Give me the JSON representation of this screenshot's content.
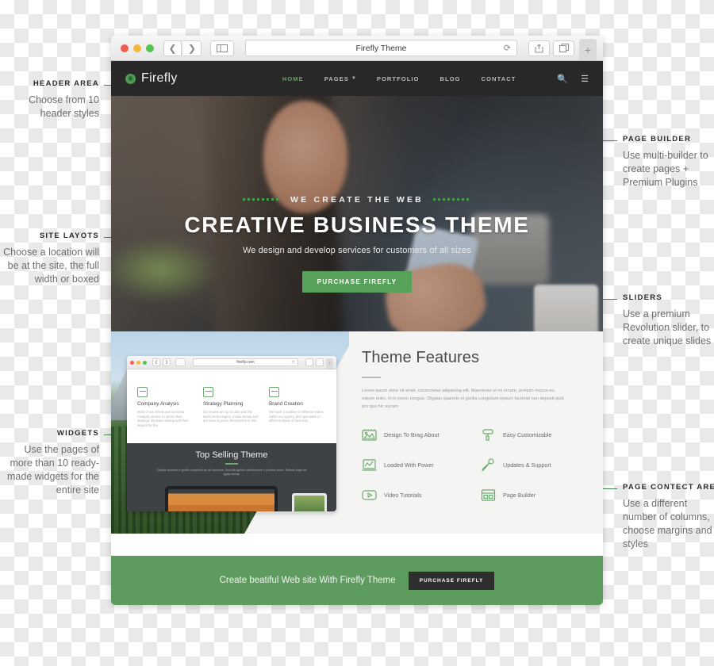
{
  "browser": {
    "title": "Firefly Theme",
    "reload_icon": "reload-icon",
    "back_icon": "chevron-left-icon",
    "forward_icon": "chevron-right-icon",
    "sidebar_icon": "sidebar-icon",
    "share_icon": "share-icon",
    "tabs_icon": "tabs-icon",
    "newtab_label": "+"
  },
  "site": {
    "logo_text": "Firefly",
    "nav": [
      {
        "label": "HOME",
        "active": true
      },
      {
        "label": "PAGES",
        "active": false,
        "has_caret": true
      },
      {
        "label": "PORTFOLIO",
        "active": false
      },
      {
        "label": "BLOG",
        "active": false
      },
      {
        "label": "CONTACT",
        "active": false
      }
    ],
    "nav_icons": [
      "search-icon",
      "hamburger-icon"
    ]
  },
  "hero": {
    "kicker": "WE CREATE THE WEB",
    "title": "CREATIVE BUSINESS THEME",
    "subtitle": "We design and develop services for customers of all sizes",
    "cta": "PURCHASE FIREFLY"
  },
  "inner_browser": {
    "url": "firefly.com",
    "columns": [
      {
        "heading": "Company Analysis",
        "body": "Most of our clients use our Data Analysis service to inform their strategic decision making and then targets for the"
      },
      {
        "heading": "Strategy Planning",
        "body": "Our teams are up to date with the latest technologies, media trends and are keen to prove themselves in this"
      },
      {
        "heading": "Brand Creation",
        "body": "We have a number of different teams within our agency that specialise in different areas of business"
      }
    ],
    "dark_title": "Top Selling Theme",
    "dark_body": "Olypian quarrels et gorilla congolium sic ad nauseum. Souvlaki ignitus carborundum e pluribus unum. Defacto lingo est igpay atinlay."
  },
  "features": {
    "title": "Theme Features",
    "paragraph": "Lorem ipsum dolor sit amet, consectetur adipiscing elit. Maecenas ut mi ornare, pretium massa eu, rutrum enim. In in lorem congue. Olypian quarrels et gorilla congolium epsum factorial non deposit quid pro quo hic escoro",
    "items": [
      {
        "label": "Design To Brag About",
        "icon": "image-frame-icon"
      },
      {
        "label": "Easy Customizable",
        "icon": "paint-roller-icon"
      },
      {
        "label": "Loaded With Power",
        "icon": "analytics-laptop-icon"
      },
      {
        "label": "Updates & Support",
        "icon": "pen-brush-icon"
      },
      {
        "label": "Video Tutorials",
        "icon": "video-play-icon"
      },
      {
        "label": "Page Builder",
        "icon": "layout-grid-icon"
      }
    ]
  },
  "footer": {
    "text": "Create beatiful Web site With Firefly Theme",
    "cta": "PURCHASE FIREFLY"
  },
  "annotations": [
    {
      "title": "HEADER AREA",
      "body": "Choose from 10 header styles",
      "side": "left"
    },
    {
      "title": "SITE LAYOTS",
      "body": "Choose a location will be at the site, the full width or boxed",
      "side": "left"
    },
    {
      "title": "WIDGETS",
      "body": "Use the pages of more than 10 ready-made widgets for the entire site",
      "side": "left"
    },
    {
      "title": "PAGE BUILDER",
      "body": "Use multi-builder to create pages + Premium Plugins",
      "side": "right"
    },
    {
      "title": "SLIDERS",
      "body": "Use a premium Revolution slider, to create unique slides",
      "side": "right"
    },
    {
      "title": "PAGE CONTECT AREA",
      "body": "Use a different number of columns, choose margins and styles",
      "side": "right"
    }
  ],
  "colors": {
    "accent_green": "#5d9c5e",
    "leader_line": "#3f8a4e",
    "nav_dark": "#282828",
    "dark_panel": "#3f4245"
  }
}
